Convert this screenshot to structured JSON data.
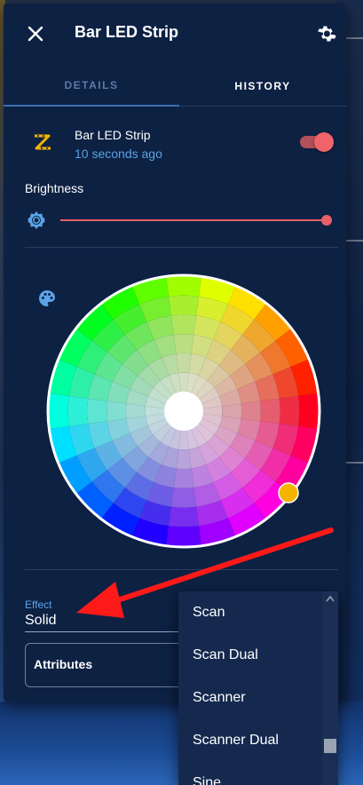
{
  "dialog": {
    "title": "Bar LED Strip",
    "tabs": [
      {
        "label": "DETAILS",
        "active": false
      },
      {
        "label": "HISTORY",
        "active": true
      }
    ]
  },
  "entity": {
    "name": "Bar LED Strip",
    "last_changed": "10 seconds ago",
    "state_on": true,
    "icon": "led-strip-icon"
  },
  "brightness": {
    "label": "Brightness",
    "value_percent": 100
  },
  "effect": {
    "label": "Effect",
    "value": "Solid",
    "options_visible": [
      "Scan",
      "Scan Dual",
      "Scanner",
      "Scanner Dual",
      "Sine"
    ]
  },
  "attributes": {
    "label": "Attributes"
  },
  "colors": {
    "dialog_bg": "#0d2143",
    "accent_red": "#e86068",
    "link_blue": "#5ba3e6",
    "selected_color": "#f5b400"
  },
  "icons": {
    "close": "close-icon",
    "settings": "gear-icon",
    "brightness": "brightness-icon",
    "palette": "palette-icon"
  }
}
